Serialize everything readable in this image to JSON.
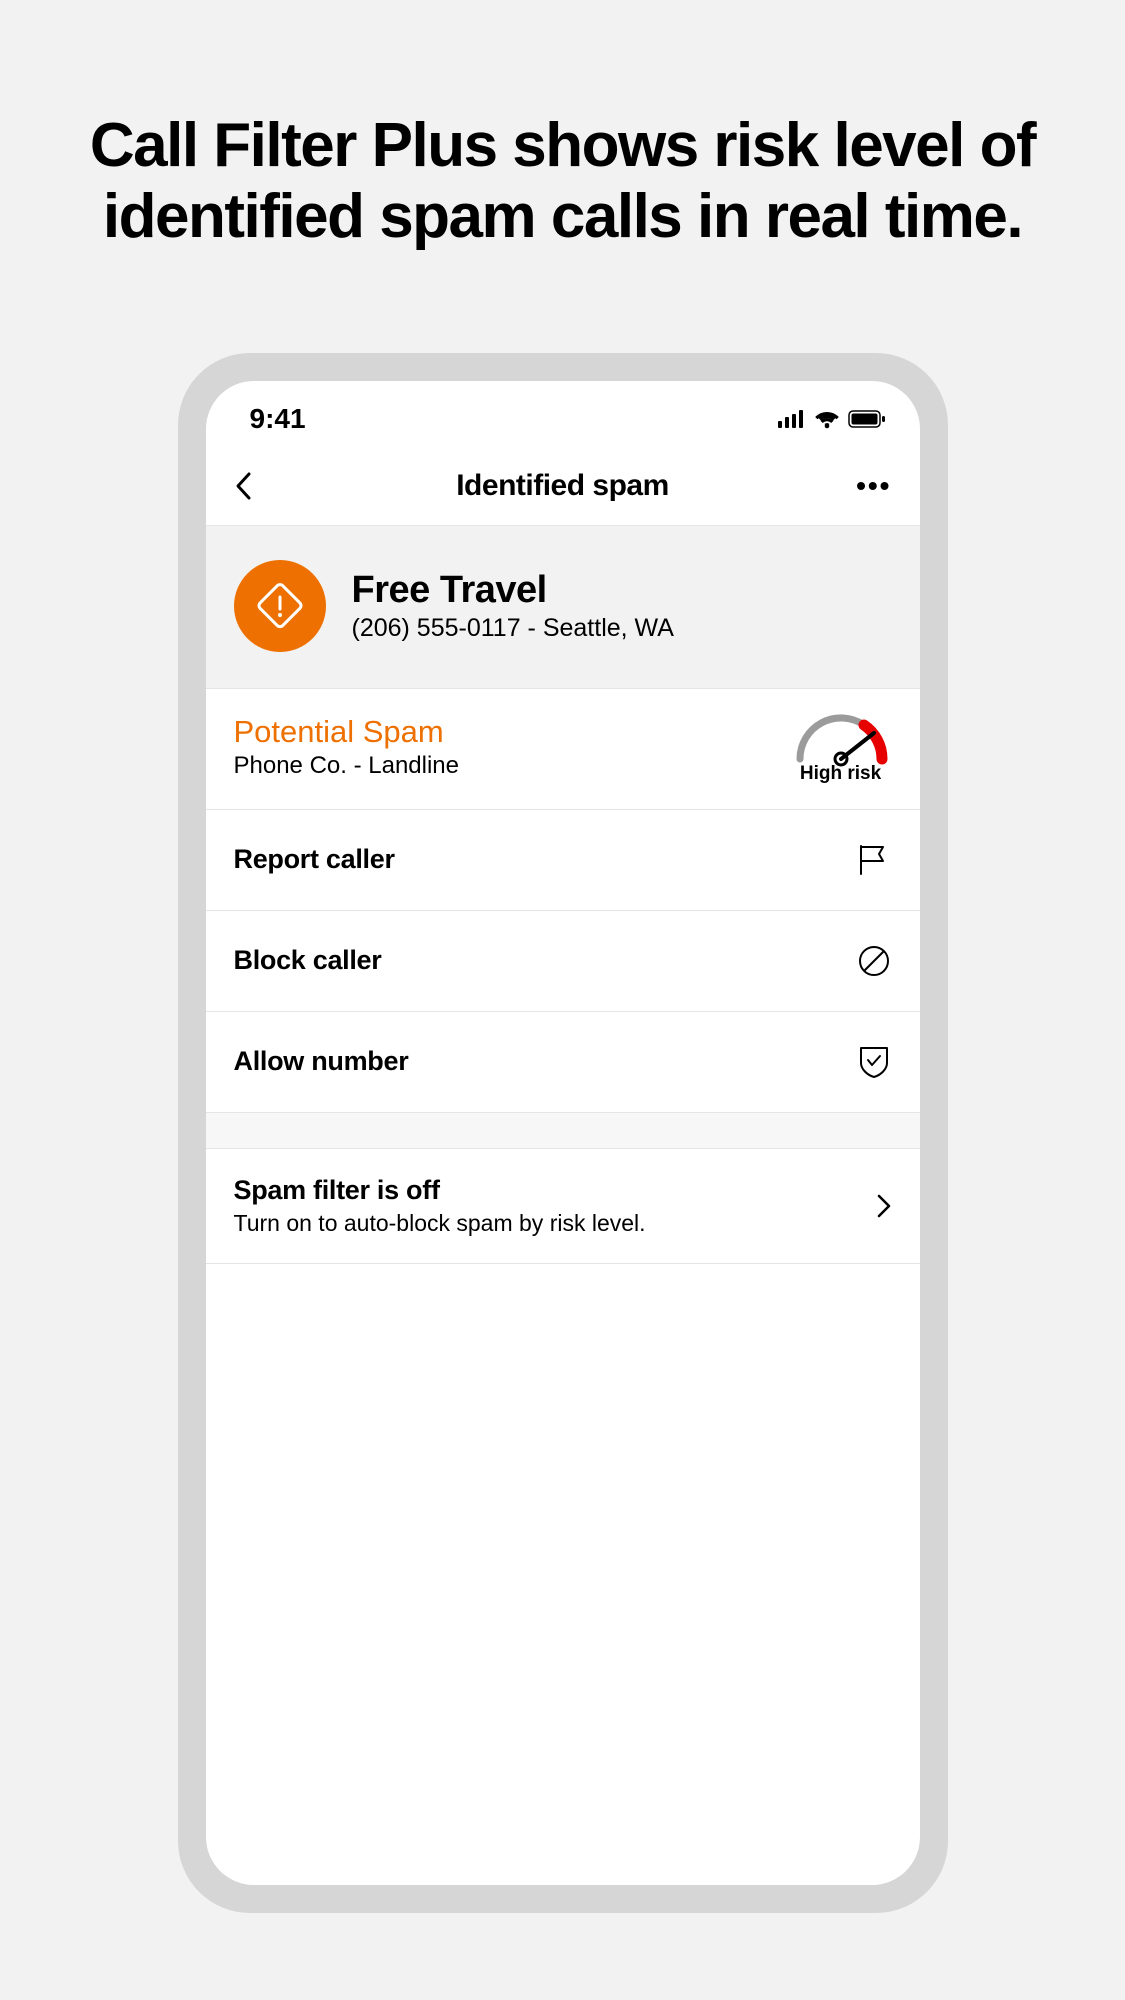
{
  "headline": "Call Filter Plus shows risk level of identified spam calls in real time.",
  "statusBar": {
    "time": "9:41"
  },
  "navBar": {
    "title": "Identified spam"
  },
  "caller": {
    "name": "Free Travel",
    "details": "(206) 555-0117 - Seattle, WA"
  },
  "spamAssessment": {
    "title": "Potential Spam",
    "carrier": "Phone Co. - Landline",
    "riskLabel": "High risk"
  },
  "actions": {
    "report": "Report caller",
    "block": "Block caller",
    "allow": "Allow number"
  },
  "spamFilter": {
    "title": "Spam filter is off",
    "subtitle": "Turn on to auto-block spam by risk level."
  }
}
